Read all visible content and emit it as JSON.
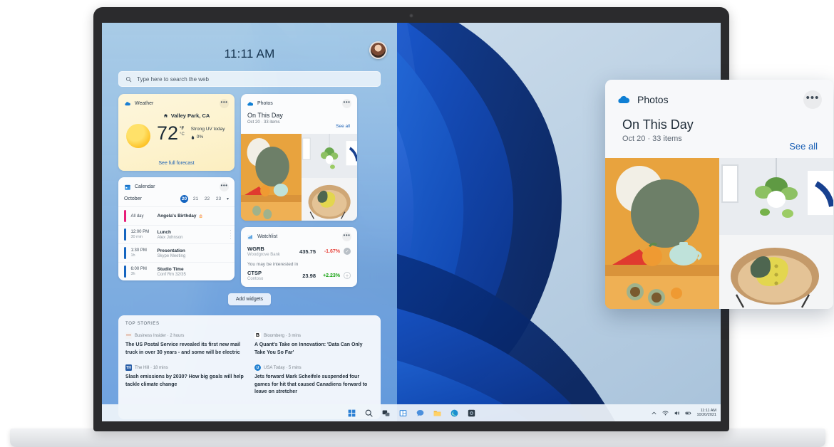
{
  "panel": {
    "clock": "11:11 AM",
    "avatar_icon": "user-avatar",
    "search": {
      "placeholder": "Type here to search the web",
      "icon": "search-icon"
    },
    "add_widgets_label": "Add widgets"
  },
  "weather": {
    "title": "Weather",
    "icon": "weather-icon",
    "more_icon": "more-options-icon",
    "location": "Valley Park, CA",
    "location_icon": "home-icon",
    "temperature": "72",
    "unit_primary": "°F",
    "unit_secondary": "°C",
    "uv_text": "Strong UV today",
    "precip_icon": "raindrop-icon",
    "precip_text": "0%",
    "link_label": "See full forecast",
    "sun_icon": "sun-icon",
    "bg_color": "#fdf3cf"
  },
  "calendar": {
    "title": "Calendar",
    "icon": "calendar-icon",
    "more_icon": "more-options-icon",
    "month": "October",
    "days": [
      "20",
      "21",
      "22",
      "23"
    ],
    "active_day": "20",
    "chevron_icon": "chevron-down-icon",
    "events": [
      {
        "time": "All day",
        "duration": "",
        "title": "Angela's Birthday",
        "subtitle": "",
        "color": "#e81e79",
        "badge_icon": "cake-icon"
      },
      {
        "time": "12:00 PM",
        "duration": "30 min",
        "title": "Lunch",
        "subtitle": "Alex Johnson",
        "color": "#1565c0",
        "badge_icon": ""
      },
      {
        "time": "1:30 PM",
        "duration": "1h",
        "title": "Presentation",
        "subtitle": "Skype Meeting",
        "color": "#1565c0",
        "badge_icon": ""
      },
      {
        "time": "6:00 PM",
        "duration": "3h",
        "title": "Studio Time",
        "subtitle": "Conf Rm 32/35",
        "color": "#1565c0",
        "badge_icon": ""
      }
    ]
  },
  "photos": {
    "title": "Photos",
    "icon": "onedrive-cloud-icon",
    "more_icon": "more-options-icon",
    "heading": "On This Day",
    "subheading": "Oct 20 · 33 items",
    "see_all_label": "See all",
    "thumb_main": "still-life-teapot-photo",
    "thumb_top": "hanging-plant-photo",
    "thumb_bottom": "rattan-chair-pillow-photo"
  },
  "watchlist": {
    "title": "Watchlist",
    "icon": "chart-bars-icon",
    "more_icon": "more-options-icon",
    "note": "You may be interested in",
    "stocks": [
      {
        "symbol": "WGRB",
        "name": "Woodgrove Bank",
        "price": "435.75",
        "change": "-1.67%",
        "change_color": "#e8473f",
        "action_icon": "check-circle-icon",
        "action_color": "#b9c0c7"
      },
      {
        "symbol": "CTSP",
        "name": "Contoso",
        "price": "23.98",
        "change": "+2.23%",
        "change_color": "#13a10e",
        "action_icon": "plus-circle-icon",
        "action_color": "#b9c0c7"
      }
    ]
  },
  "news": {
    "header": "TOP STORIES",
    "stories": [
      {
        "source": "Business Insider",
        "time": "2 hours",
        "logo": "business-insider-logo",
        "logo_char": "—",
        "logo_bg": "#f1f2f4",
        "logo_color": "#c8551f",
        "headline": "The US Postal Service revealed its first new mail truck in over 30 years - and some will be electric"
      },
      {
        "source": "Bloomberg",
        "time": "3 mins",
        "logo": "bloomberg-logo",
        "logo_char": "B",
        "logo_bg": "#ffffff",
        "logo_color": "#000000",
        "headline": "A Quant's Take on Innovation: 'Data Can Only Take You So Far'"
      },
      {
        "source": "The Hill",
        "time": "18 mins",
        "logo": "the-hill-logo",
        "logo_char": "█",
        "logo_bg": "#2a5fa8",
        "logo_color": "#ffffff",
        "headline": "Slash emissions by 2030? How big goals will help tackle climate change"
      },
      {
        "source": "USA Today",
        "time": "5 mins",
        "logo": "usa-today-logo",
        "logo_char": "●",
        "logo_bg": "#1f7fd0",
        "logo_color": "#ffffff",
        "headline": "Jets forward Mark Scheifele suspended four games for hit that caused Canadiens forward to leave on stretcher"
      }
    ]
  },
  "callout": {
    "title": "Photos",
    "icon": "onedrive-cloud-icon",
    "more_icon": "more-options-icon",
    "heading": "On This Day",
    "subheading": "Oct 20 · 33 items",
    "see_all_label": "See all"
  },
  "taskbar": {
    "icons": [
      "start-icon",
      "search-icon",
      "task-view-icon",
      "widgets-icon",
      "chat-icon",
      "file-explorer-icon",
      "edge-icon",
      "camera-app-icon"
    ],
    "tray_icons": [
      "chevron-up-icon",
      "wifi-icon",
      "volume-icon",
      "battery-icon"
    ],
    "clock_time": "11:11 AM",
    "clock_date": "10/20/2021"
  }
}
